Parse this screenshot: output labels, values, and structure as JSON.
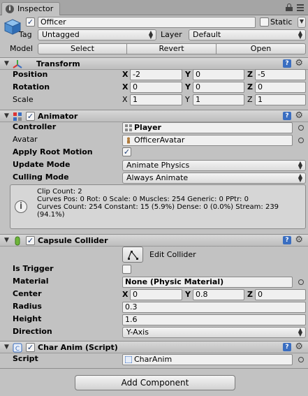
{
  "window": {
    "tab_label": "Inspector"
  },
  "gameobject": {
    "active": true,
    "name": "Officer",
    "static_label": "Static",
    "static_checked": false,
    "tag_label": "Tag",
    "tag_value": "Untagged",
    "layer_label": "Layer",
    "layer_value": "Default",
    "model_label": "Model",
    "model_buttons": [
      "Select",
      "Revert",
      "Open"
    ]
  },
  "transform": {
    "title": "Transform",
    "position_label": "Position",
    "rotation_label": "Rotation",
    "scale_label": "Scale",
    "axis_labels": [
      "X",
      "Y",
      "Z"
    ],
    "position": [
      "-2",
      "0",
      "-5"
    ],
    "rotation": [
      "0",
      "0",
      "0"
    ],
    "scale": [
      "1",
      "1",
      "1"
    ]
  },
  "animator": {
    "title": "Animator",
    "enabled": true,
    "controller_label": "Controller",
    "controller_value": "Player",
    "avatar_label": "Avatar",
    "avatar_value": "OfficerAvatar",
    "apply_root_motion_label": "Apply Root Motion",
    "apply_root_motion": true,
    "update_mode_label": "Update Mode",
    "update_mode_value": "Animate Physics",
    "culling_mode_label": "Culling Mode",
    "culling_mode_value": "Always Animate",
    "info_lines": [
      "Clip Count: 2",
      "Curves Pos: 0 Rot: 0 Scale: 0 Muscles: 254 Generic: 0 PPtr: 0",
      "Curves Count: 254 Constant: 15 (5.9%) Dense: 0 (0.0%) Stream: 239",
      "(94.1%)"
    ]
  },
  "capsule_collider": {
    "title": "Capsule Collider",
    "enabled": true,
    "edit_collider_label": "Edit Collider",
    "is_trigger_label": "Is Trigger",
    "is_trigger": false,
    "material_label": "Material",
    "material_value": "None (Physic Material)",
    "center_label": "Center",
    "center": [
      "0",
      "0.8",
      "0"
    ],
    "radius_label": "Radius",
    "radius_value": "0.3",
    "height_label": "Height",
    "height_value": "1.6",
    "direction_label": "Direction",
    "direction_value": "Y-Axis"
  },
  "char_anim": {
    "title": "Char Anim (Script)",
    "enabled": true,
    "script_label": "Script",
    "script_value": "CharAnim"
  },
  "add_component_label": "Add Component",
  "icons": {
    "fold": "triangle-down",
    "help": "?",
    "gear": "⚙",
    "check": "✓",
    "arrows": "⬍"
  }
}
